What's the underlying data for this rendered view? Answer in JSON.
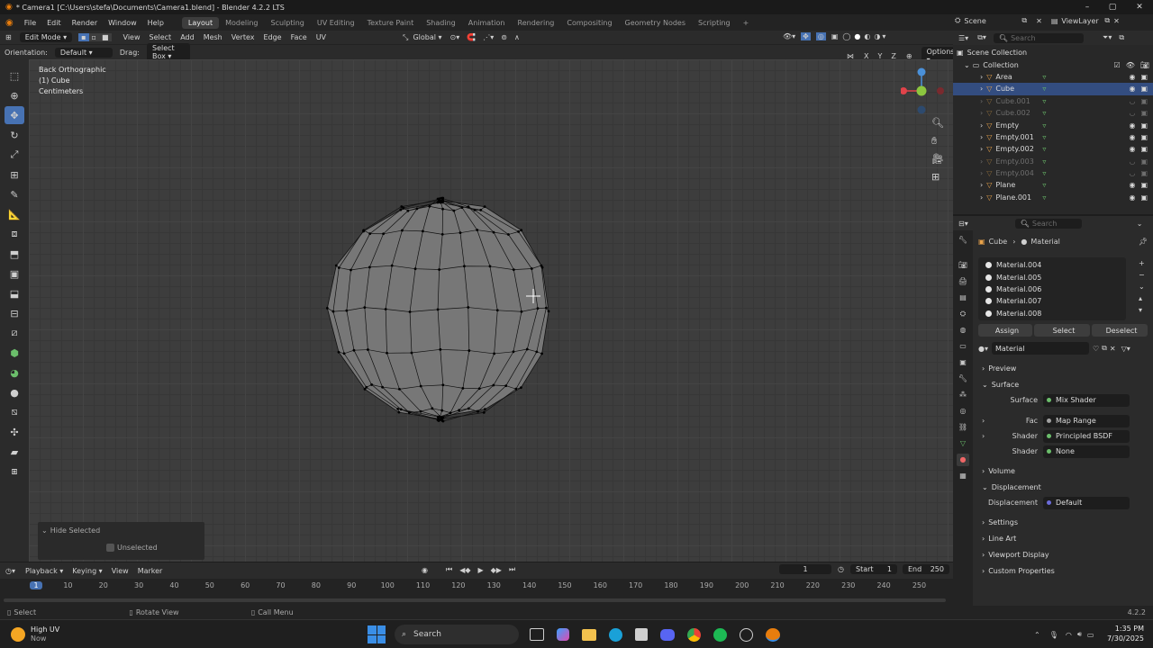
{
  "window": {
    "title": "* Camera1 [C:\\Users\\stefa\\Documents\\Camera1.blend] - Blender 4.2.2 LTS",
    "minimize": "–",
    "maximize": "▢",
    "close": "✕"
  },
  "menubar": {
    "menus": [
      "File",
      "Edit",
      "Render",
      "Window",
      "Help"
    ],
    "workspaces": [
      "Layout",
      "Modeling",
      "Sculpting",
      "UV Editing",
      "Texture Paint",
      "Shading",
      "Animation",
      "Rendering",
      "Compositing",
      "Geometry Nodes",
      "Scripting"
    ],
    "active_workspace": "Layout",
    "add_tab": "+",
    "scene": "Scene",
    "view_layer": "ViewLayer"
  },
  "viewport_header": {
    "mode": "Edit Mode",
    "menus": [
      "View",
      "Select",
      "Add",
      "Mesh",
      "Vertex",
      "Edge",
      "Face",
      "UV"
    ],
    "transform": "Global",
    "options": "Options"
  },
  "tool_header": {
    "orientation_label": "Orientation:",
    "orientation_value": "Default",
    "drag_label": "Drag:",
    "drag_value": "Select Box",
    "axes": [
      "X",
      "Y",
      "Z"
    ]
  },
  "viewport": {
    "view_name": "Back Orthographic",
    "object": "(1) Cube",
    "units": "Centimeters"
  },
  "gizmo": {
    "colors": {
      "x": "#e0434a",
      "y": "#8cc63f",
      "z": "#4a90d9"
    }
  },
  "hide_panel": {
    "title": "Hide Selected",
    "checkbox_label": "Unselected"
  },
  "timeline": {
    "menus": [
      "Playback",
      "Keying",
      "View",
      "Marker"
    ],
    "current_frame": "1",
    "start_label": "Start",
    "start_value": "1",
    "end_label": "End",
    "end_value": "250",
    "ticks": [
      "1",
      "10",
      "20",
      "30",
      "40",
      "50",
      "60",
      "70",
      "80",
      "90",
      "100",
      "110",
      "120",
      "130",
      "140",
      "150",
      "160",
      "170",
      "180",
      "190",
      "200",
      "210",
      "220",
      "230",
      "240",
      "250"
    ]
  },
  "statusbar": {
    "select": "Select",
    "rotate": "Rotate View",
    "call_menu": "Call Menu",
    "version": "4.2.2"
  },
  "outliner": {
    "search_placeholder": "Search",
    "scene_collection": "Scene Collection",
    "collection": "Collection",
    "items": [
      {
        "name": "Area",
        "state": "normal"
      },
      {
        "name": "Cube",
        "state": "selected"
      },
      {
        "name": "Cube.001",
        "state": "dim"
      },
      {
        "name": "Cube.002",
        "state": "dim"
      },
      {
        "name": "Empty",
        "state": "normal"
      },
      {
        "name": "Empty.001",
        "state": "normal"
      },
      {
        "name": "Empty.002",
        "state": "normal"
      },
      {
        "name": "Empty.003",
        "state": "dim"
      },
      {
        "name": "Empty.004",
        "state": "dim"
      },
      {
        "name": "Plane",
        "state": "normal"
      },
      {
        "name": "Plane.001",
        "state": "normal"
      }
    ]
  },
  "properties": {
    "search_placeholder": "Search",
    "breadcrumb": [
      "Cube",
      "Material"
    ],
    "materials": [
      "Material.004",
      "Material.005",
      "Material.006",
      "Material.007",
      "Material.008"
    ],
    "buttons": [
      "Assign",
      "Select",
      "Deselect"
    ],
    "material_name": "Material",
    "sections": {
      "preview": "Preview",
      "surface": "Surface",
      "volume": "Volume",
      "displacement": "Displacement",
      "settings": "Settings",
      "line_art": "Line Art",
      "viewport_display": "Viewport Display",
      "custom_properties": "Custom Properties"
    },
    "fields": {
      "surface_label": "Surface",
      "surface_value": "Mix Shader",
      "fac_label": "Fac",
      "fac_value": "Map Range",
      "shader1_label": "Shader",
      "shader1_value": "Principled BSDF",
      "shader2_label": "Shader",
      "shader2_value": "None",
      "disp_label": "Displacement",
      "disp_value": "Default"
    }
  },
  "taskbar": {
    "weather_title": "High UV",
    "weather_sub": "Now",
    "search": "Search",
    "time": "1:35 PM",
    "date": "7/30/2025"
  }
}
